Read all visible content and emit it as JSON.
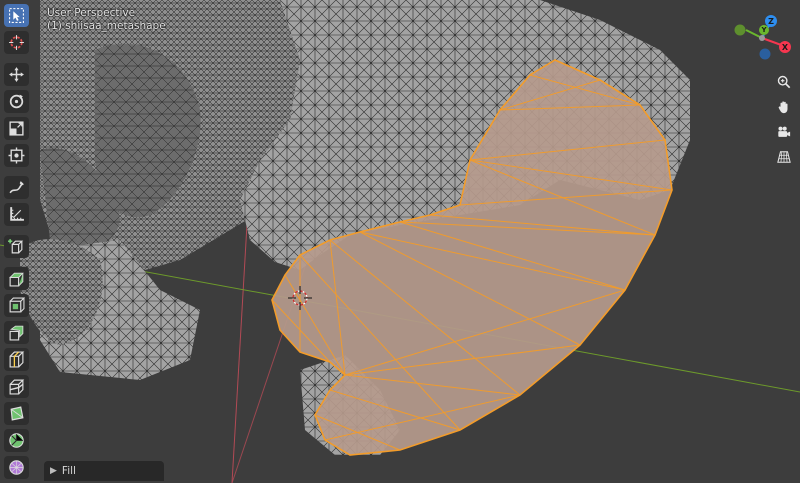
{
  "viewport": {
    "title": "User Perspective",
    "object": "(1) shiisaa_metashape"
  },
  "toolbar": {
    "tools": [
      {
        "name": "select-box-tool",
        "icon": "cursor-arrow-icon",
        "active": true
      },
      {
        "name": "cursor-tool",
        "icon": "3d-cursor-icon",
        "active": false
      },
      {
        "name": "move-tool",
        "icon": "move-arrows-icon",
        "active": false
      },
      {
        "name": "rotate-tool",
        "icon": "rotate-icon",
        "active": false
      },
      {
        "name": "scale-tool",
        "icon": "scale-icon",
        "active": false
      },
      {
        "name": "transform-tool",
        "icon": "transform-icon",
        "active": false
      },
      {
        "name": "annotate-tool",
        "icon": "annotate-pen-icon",
        "active": false
      },
      {
        "name": "measure-tool",
        "icon": "measure-ruler-icon",
        "active": false
      },
      {
        "name": "add-cube-tool",
        "icon": "add-cube-icon",
        "active": false
      },
      {
        "name": "extrude-tool",
        "icon": "extrude-region-icon",
        "active": false
      },
      {
        "name": "inset-tool",
        "icon": "inset-faces-icon",
        "active": false
      },
      {
        "name": "bevel-tool",
        "icon": "bevel-icon",
        "active": false
      },
      {
        "name": "loop-cut-tool",
        "icon": "loop-cut-icon",
        "active": false
      },
      {
        "name": "knife-tool",
        "icon": "knife-icon",
        "active": false
      },
      {
        "name": "poly-build-tool",
        "icon": "poly-build-icon",
        "active": false
      },
      {
        "name": "spin-tool",
        "icon": "spin-icon",
        "active": false
      },
      {
        "name": "smooth-tool",
        "icon": "smooth-vertices-icon",
        "active": false
      }
    ]
  },
  "gizmo": {
    "axes": [
      {
        "label": "X",
        "color": "#f6364f"
      },
      {
        "label": "Y",
        "color": "#6ab72d"
      },
      {
        "label": "Z",
        "color": "#2e8ef0"
      }
    ]
  },
  "nav_buttons": [
    {
      "name": "zoom-button",
      "icon": "zoom-icon"
    },
    {
      "name": "pan-button",
      "icon": "hand-icon"
    },
    {
      "name": "camera-button",
      "icon": "camera-icon"
    },
    {
      "name": "ortho-toggle-button",
      "icon": "grid-perspective-icon"
    }
  ],
  "operator_panel": {
    "label": "Fill",
    "collapsed": true
  },
  "colors": {
    "background": "#3d3d3d",
    "mesh_face": "#9a9a9a",
    "mesh_wire": "#1e1e1e",
    "selected_face": "#b59a8c",
    "selected_edge": "#f39c2a",
    "x_axis_line": "#b24a55",
    "y_axis_line": "#6d9a2b",
    "active_tool": "#4772b3"
  }
}
